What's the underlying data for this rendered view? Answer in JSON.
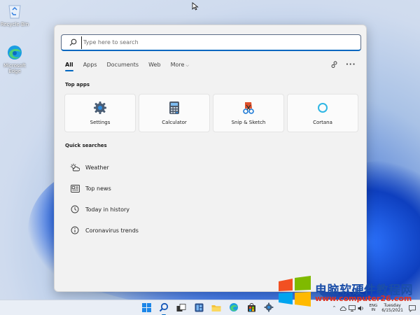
{
  "desktop": {
    "icons": [
      {
        "label": "Recycle Bin",
        "icon": "recycle-bin-icon"
      },
      {
        "label": "Microsoft Edge",
        "icon": "edge-icon"
      }
    ]
  },
  "search": {
    "placeholder": "Type here to search",
    "tabs": [
      {
        "label": "All",
        "active": true
      },
      {
        "label": "Apps"
      },
      {
        "label": "Documents"
      },
      {
        "label": "Web"
      },
      {
        "label": "More",
        "icon": "chevron-down-icon"
      }
    ],
    "top_apps_title": "Top apps",
    "top_apps": [
      {
        "label": "Settings",
        "icon": "settings-gear-icon"
      },
      {
        "label": "Calculator",
        "icon": "calculator-icon"
      },
      {
        "label": "Snip & Sketch",
        "icon": "snip-sketch-icon"
      },
      {
        "label": "Cortana",
        "icon": "cortana-icon"
      }
    ],
    "quick_searches_title": "Quick searches",
    "quick_searches": [
      {
        "label": "Weather",
        "icon": "weather-icon"
      },
      {
        "label": "Top news",
        "icon": "news-icon"
      },
      {
        "label": "Today in history",
        "icon": "history-icon"
      },
      {
        "label": "Coronavirus trends",
        "icon": "info-icon"
      }
    ]
  },
  "watermark": {
    "title": "电脑软硬件教程网",
    "url": "www.computer26.com"
  },
  "taskbar": {
    "tray": {
      "lang_line1": "ENG",
      "lang_line2": "IN",
      "day": "Tuesday",
      "date": "6/15/2021"
    }
  },
  "colors": {
    "accent": "#0067c0",
    "flyout_bg": "#f2f2f2",
    "taskbar_bg": "#e9eef6"
  }
}
